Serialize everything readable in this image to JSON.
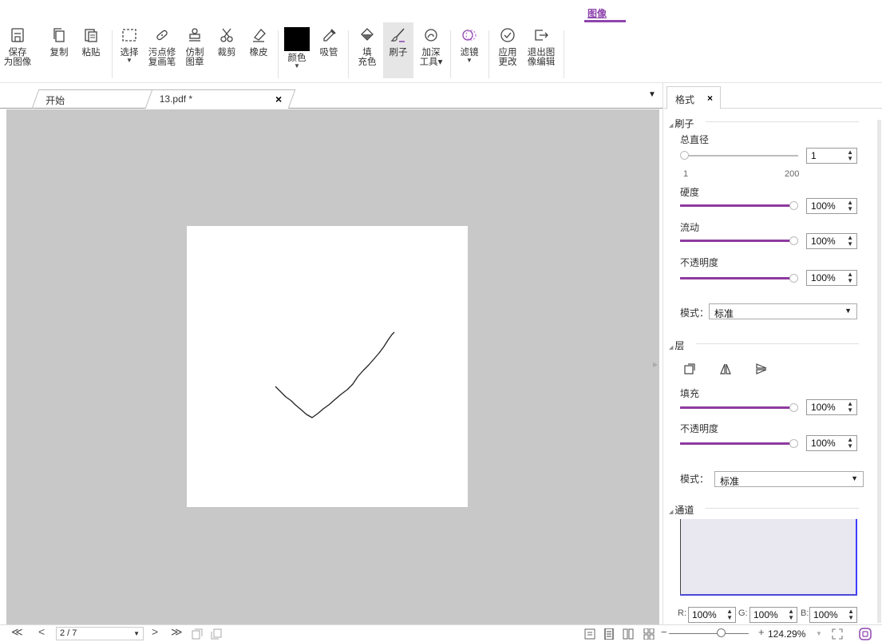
{
  "ribbon": {
    "active_tab": "图像",
    "buttons": {
      "save_l1": "保存",
      "save_l2": "为图像",
      "copy": "复制",
      "paste": "粘贴",
      "select": "选择",
      "spot_l1": "污点修",
      "spot_l2": "复画笔",
      "clone_l1": "仿制",
      "clone_l2": "图章",
      "crop": "裁剪",
      "eraser": "橡皮",
      "color": "颜色",
      "eyedropper": "吸管",
      "fill_l1": "填",
      "fill_l2": "充色",
      "brush": "刷子",
      "burn_l1": "加深",
      "burn_l2": "工具",
      "filter": "滤镜",
      "apply_l1": "应用",
      "apply_l2": "更改",
      "exit_l1": "退出图",
      "exit_l2": "像编辑"
    },
    "current_color": "#000000",
    "accent": "#8e44ad"
  },
  "doc_tabs": {
    "start": "开始",
    "file": "13.pdf *",
    "close": "×"
  },
  "status": {
    "first": "≪",
    "prev": "<",
    "page": "2 / 7",
    "next": ">",
    "last": "≫",
    "zoom": "124.29%",
    "zoom_minus": "−",
    "zoom_plus": "+"
  },
  "panel": {
    "tab": "格式",
    "tab_close": "×",
    "brush": {
      "title": "刷子",
      "diameter_label": "总直径",
      "diameter_value": "1",
      "diameter_min": "1",
      "diameter_max": "200",
      "hardness_label": "硬度",
      "hardness_value": "100%",
      "flow_label": "流动",
      "flow_value": "100%",
      "opacity_label": "不透明度",
      "opacity_value": "100%",
      "mode_label": "模式：",
      "mode_value": "标准"
    },
    "layer": {
      "title": "层",
      "fill_label": "填充",
      "fill_value": "100%",
      "opacity_label": "不透明度",
      "opacity_value": "100%",
      "mode_label": "模式：",
      "mode_value": "标准"
    },
    "channel": {
      "title": "通道",
      "r_label": "R:",
      "r_value": "100%",
      "g_label": "G:",
      "g_value": "100%",
      "b_label": "B:",
      "b_value": "100%"
    },
    "slider_color": "#8e3aa0"
  }
}
